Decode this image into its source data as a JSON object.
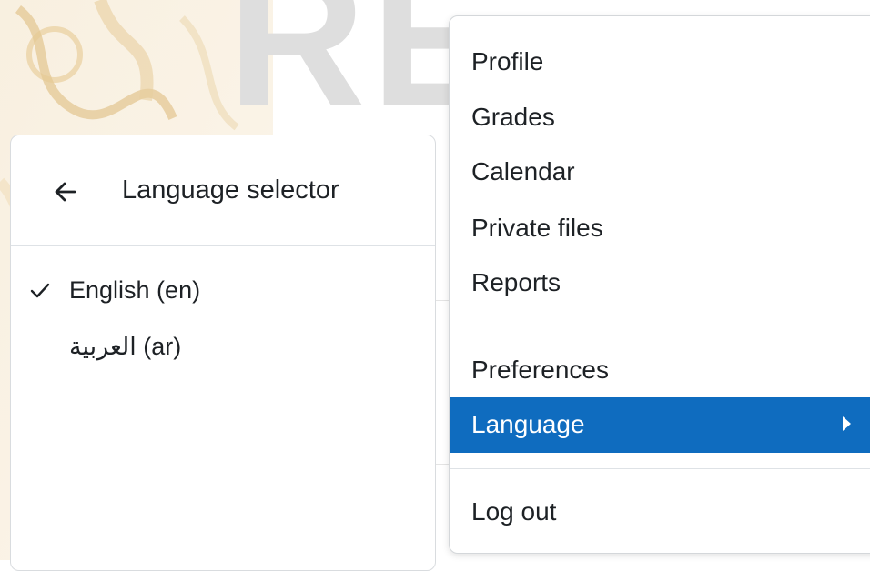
{
  "language_panel": {
    "title": "Language selector",
    "back_icon": "arrow-left-icon",
    "options": [
      {
        "label": "English (en)",
        "selected": true,
        "check_icon": "check-icon"
      },
      {
        "label": "العربية (ar)",
        "selected": false
      }
    ]
  },
  "user_menu": {
    "items": [
      {
        "label": "Profile"
      },
      {
        "label": "Grades"
      },
      {
        "label": "Calendar"
      },
      {
        "label": "Private files"
      },
      {
        "label": "Reports"
      },
      {
        "label": "Preferences"
      },
      {
        "label": "Language",
        "active": true,
        "submenu_icon": "caret-right-icon"
      },
      {
        "label": "Log out"
      }
    ]
  },
  "colors": {
    "accent": "#0f6cbf",
    "text": "#1d2125",
    "divider": "#dee2e6",
    "background_logo": "#dedede",
    "background_art": "#e8d2a8"
  }
}
